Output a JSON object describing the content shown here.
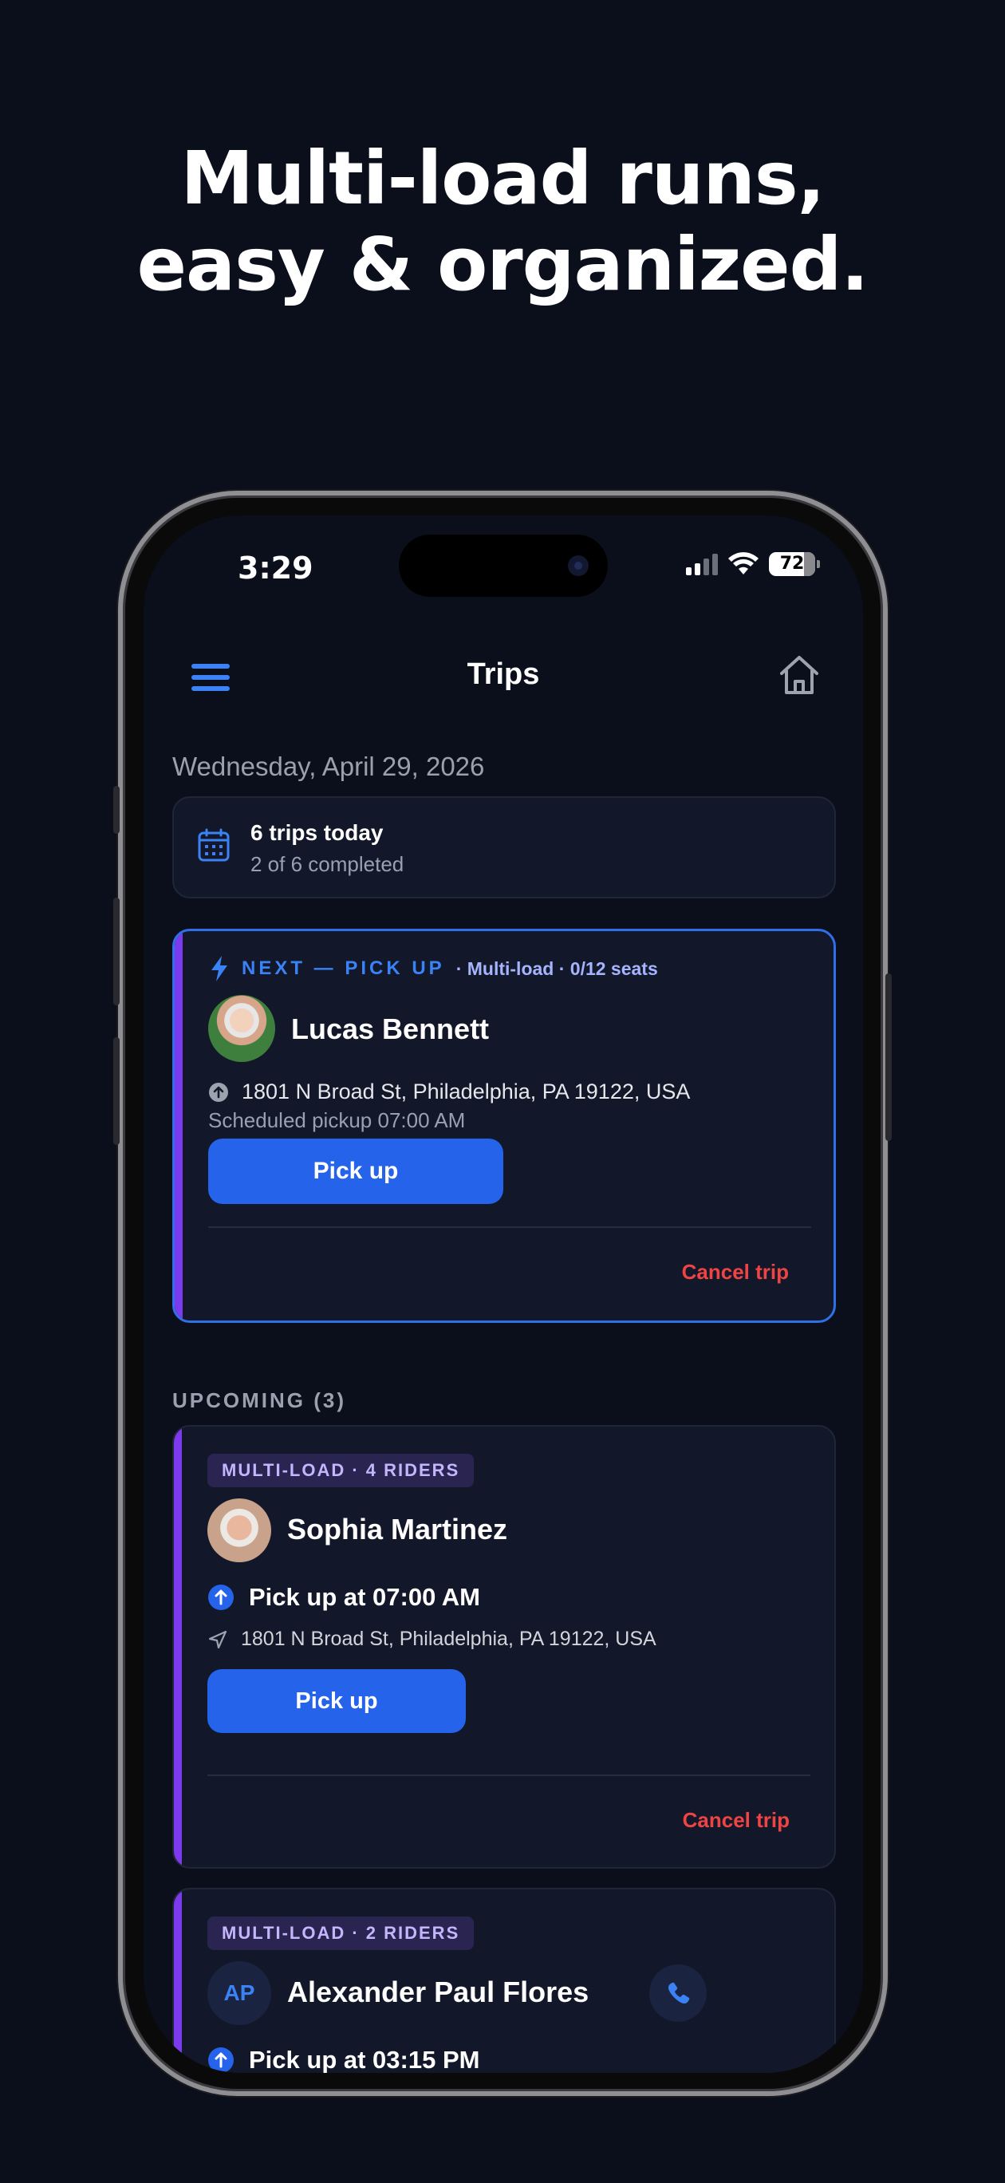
{
  "headline": {
    "line1": "Multi-load runs,",
    "line2": "easy & organized."
  },
  "status_bar": {
    "time": "3:29",
    "battery": "72"
  },
  "nav": {
    "title": "Trips",
    "menu_icon": "hamburger-menu-icon",
    "home_icon": "home-icon"
  },
  "date": "Wednesday, April 29, 2026",
  "summary": {
    "icon": "calendar-icon",
    "title": "6 trips today",
    "subtitle": "2 of 6 completed"
  },
  "next_trip": {
    "label": "NEXT — PICK UP",
    "meta": "· Multi-load · 0/12 seats",
    "name": "Lucas Bennett",
    "address": "1801 N Broad St, Philadelphia, PA 19122, USA",
    "scheduled": "Scheduled pickup 07:00 AM",
    "button": "Pick up",
    "cancel": "Cancel trip"
  },
  "upcoming": {
    "label": "UPCOMING (3)",
    "trips": [
      {
        "badge": "MULTI-LOAD · 4 RIDERS",
        "name": "Sophia Martinez",
        "pickup": "Pick up at 07:00 AM",
        "address": "1801 N Broad St, Philadelphia, PA 19122, USA",
        "button": "Pick up",
        "cancel": "Cancel trip"
      },
      {
        "badge": "MULTI-LOAD · 2 RIDERS",
        "initials": "AP",
        "name": "Alexander Paul Flores",
        "pickup": "Pick up at 03:15 PM"
      }
    ]
  },
  "colors": {
    "background": "#0b0f1c",
    "card": "#121829",
    "accent_blue": "#2563eb",
    "accent_purple": "#7c3aed",
    "cancel_red": "#ef4444"
  }
}
